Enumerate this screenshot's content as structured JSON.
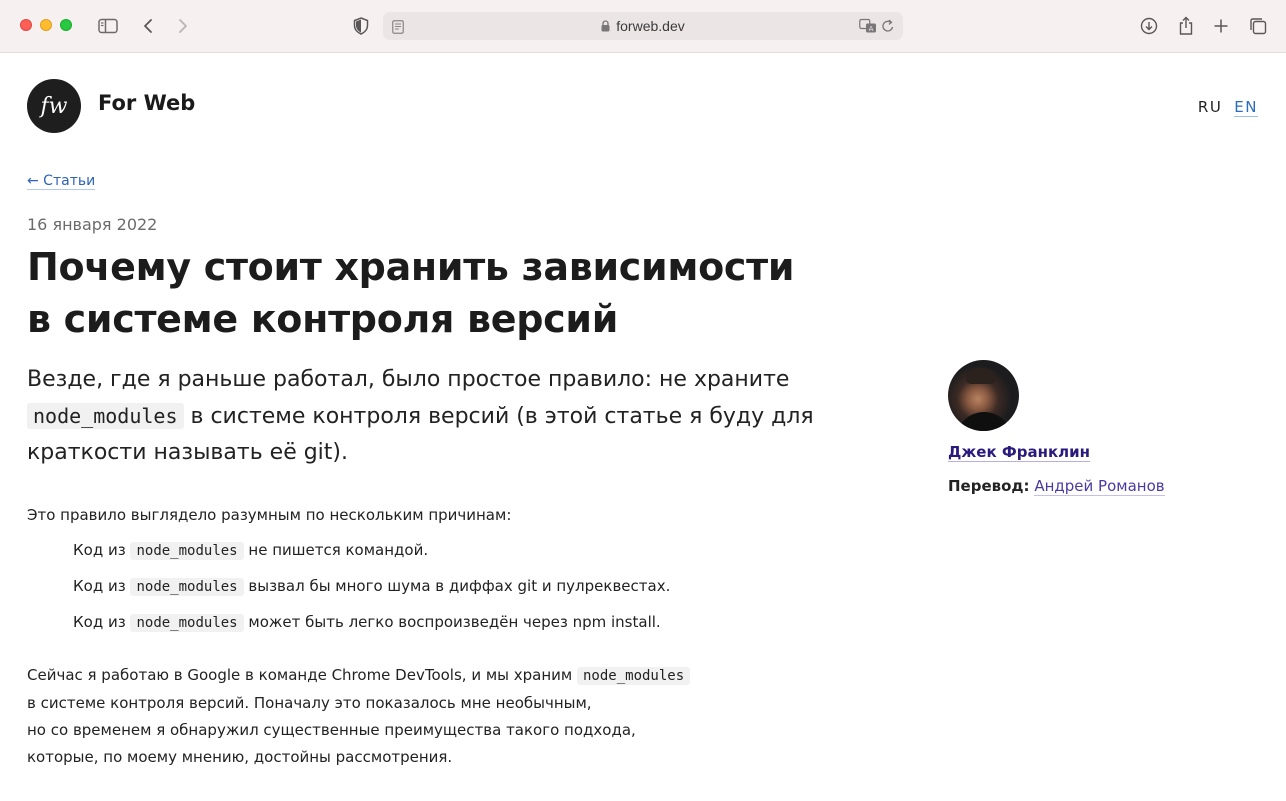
{
  "browser": {
    "url": "forweb.dev",
    "icons": [
      "sidebar-icon",
      "back-icon",
      "forward-icon",
      "shield-icon",
      "reader-icon",
      "lock-icon",
      "translate-icon",
      "reload-icon",
      "download-icon",
      "share-icon",
      "new-tab-icon",
      "tabs-overview-icon"
    ]
  },
  "site": {
    "logo_text": "fw",
    "name": "For Web",
    "lang_ru": "RU",
    "lang_en": "EN"
  },
  "article": {
    "back_link": "← Статьи",
    "date": "16 января 2022",
    "title_line1": "Почему стоит хранить зависимости",
    "title_line2": "в системе контроля версий",
    "lead_part1": "Везде, где я раньше работал, было простое правило: не храните",
    "lead_code": "node_modules",
    "lead_part2": " в системе контроля версий (в этой статье я буду для краткости называть её git).",
    "p1": "Это правило выглядело разумным по нескольким причинам:",
    "list": [
      {
        "prefix": "Код из ",
        "code": "node_modules",
        "suffix": " не пишется командой."
      },
      {
        "prefix": "Код из ",
        "code": "node_modules",
        "suffix": " вызвал бы много шума в диффах git и пулреквестах."
      },
      {
        "prefix": "Код из ",
        "code": "node_modules",
        "suffix": " может быть легко воспроизведён через npm install."
      }
    ],
    "p2_part1": "Сейчас я работаю в Google в команде Chrome DevTools, и мы храним ",
    "p2_code": "node_modules",
    "p2_line2": "в системе контроля версий. Поначалу это показалось мне необычным,",
    "p2_line3": "но со временем я обнаружил существенные преимущества такого подхода,",
    "p2_line4": "которые, по моему мнению, достойны рассмотрения."
  },
  "author": {
    "name": "Джек Франклин",
    "translation_label": "Перевод:",
    "translator": "Андрей Романов"
  }
}
